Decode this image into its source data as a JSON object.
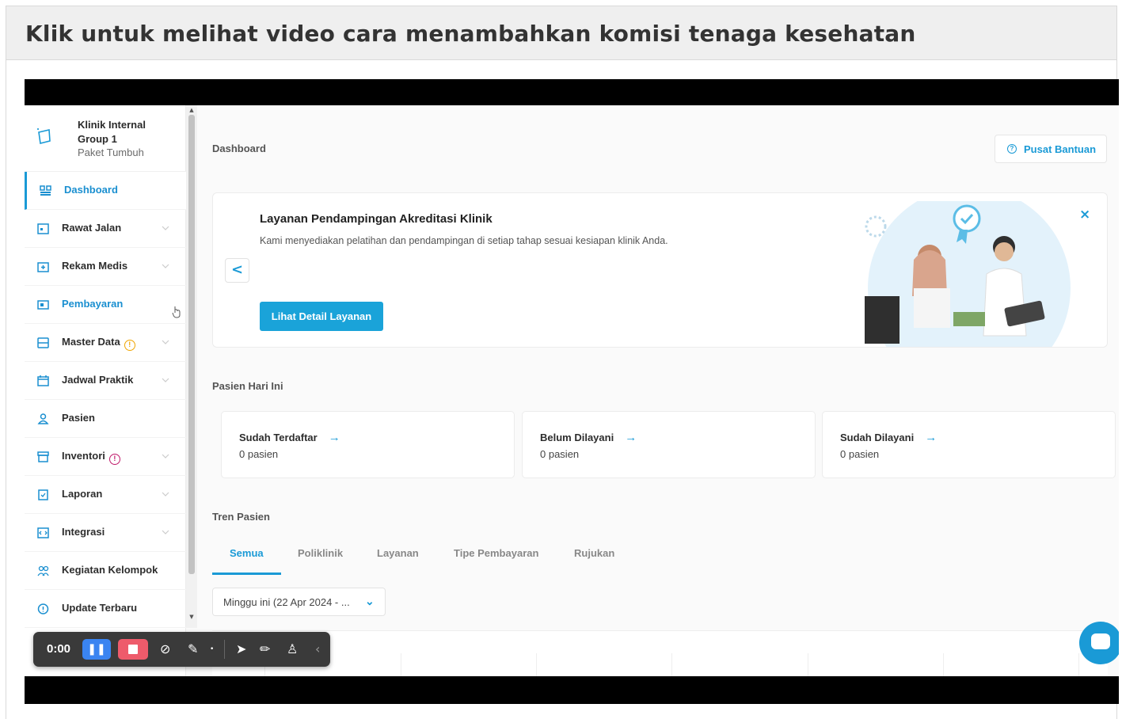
{
  "header": {
    "title": "Klik untuk melihat video cara menambahkan komisi tenaga kesehatan"
  },
  "sidebar": {
    "clinic_name": "Klinik Internal Group 1",
    "clinic_plan": "Paket Tumbuh",
    "items": [
      {
        "label": "Dashboard",
        "icon": "dashboard-icon"
      },
      {
        "label": "Rawat Jalan",
        "icon": "outpatient-icon"
      },
      {
        "label": "Rekam Medis",
        "icon": "medical-record-icon"
      },
      {
        "label": "Pembayaran",
        "icon": "payment-icon"
      },
      {
        "label": "Master Data",
        "icon": "database-icon",
        "badge": "!"
      },
      {
        "label": "Jadwal Praktik",
        "icon": "calendar-icon"
      },
      {
        "label": "Pasien",
        "icon": "patient-icon"
      },
      {
        "label": "Inventori",
        "icon": "inventory-icon",
        "badge": "!"
      },
      {
        "label": "Laporan",
        "icon": "report-icon"
      },
      {
        "label": "Integrasi",
        "icon": "integration-icon"
      },
      {
        "label": "Kegiatan Kelompok",
        "icon": "group-icon"
      },
      {
        "label": "Update Terbaru",
        "icon": "info-icon"
      }
    ]
  },
  "main": {
    "breadcrumb": "Dashboard",
    "help_label": "Pusat Bantuan",
    "banner": {
      "title": "Layanan Pendampingan Akreditasi Klinik",
      "subtitle": "Kami menyediakan pelatihan dan pendampingan di setiap tahap sesuai kesiapan klinik Anda.",
      "button": "Lihat Detail Layanan",
      "close": "×",
      "prev": "<"
    },
    "today_label": "Pasien Hari Ini",
    "stats": [
      {
        "title": "Sudah Terdaftar",
        "value": "0 pasien"
      },
      {
        "title": "Belum Dilayani",
        "value": "0 pasien"
      },
      {
        "title": "Sudah Dilayani",
        "value": "0 pasien"
      }
    ],
    "trend_label": "Tren Pasien",
    "tabs": [
      "Semua",
      "Poliklinik",
      "Layanan",
      "Tipe Pembayaran",
      "Rujukan"
    ],
    "date_range": "Minggu ini (22 Apr 2024 - ..."
  },
  "recorder": {
    "time": "0:00"
  },
  "colors": {
    "accent": "#1a9ad6",
    "stop": "#ee5b6b",
    "pause": "#3a84f1",
    "warn": "#f0a500",
    "alert": "#c0186a"
  }
}
